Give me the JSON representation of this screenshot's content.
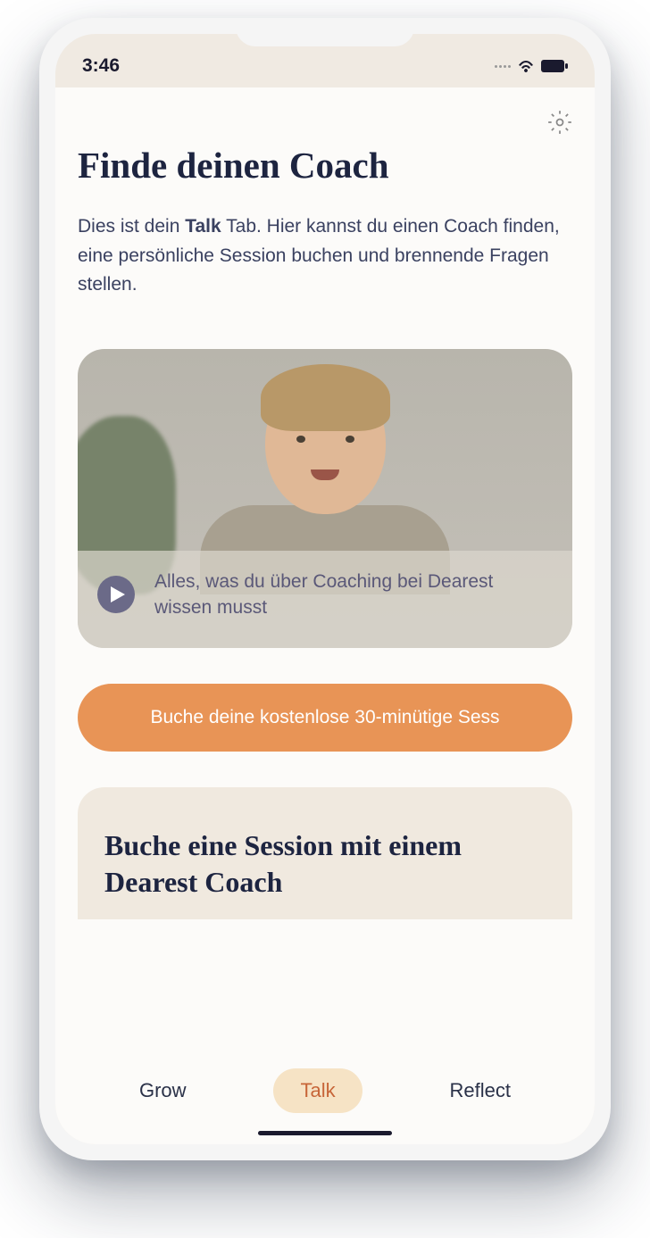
{
  "status": {
    "time": "3:46"
  },
  "header": {
    "title": "Finde deinen Coach"
  },
  "intro": {
    "part1": "Dies ist dein ",
    "bold": "Talk",
    "part2": " Tab. Hier kannst du einen Coach finden, eine persönliche Session buchen und brennende Fragen stellen."
  },
  "video": {
    "caption": "Alles, was du über Coaching bei Dearest wissen musst"
  },
  "cta": {
    "label": "Buche deine kostenlose 30-minütige Sess"
  },
  "section": {
    "title": "Buche eine Session mit einem Dearest Coach"
  },
  "tabs": {
    "grow": "Grow",
    "talk": "Talk",
    "reflect": "Reflect"
  }
}
